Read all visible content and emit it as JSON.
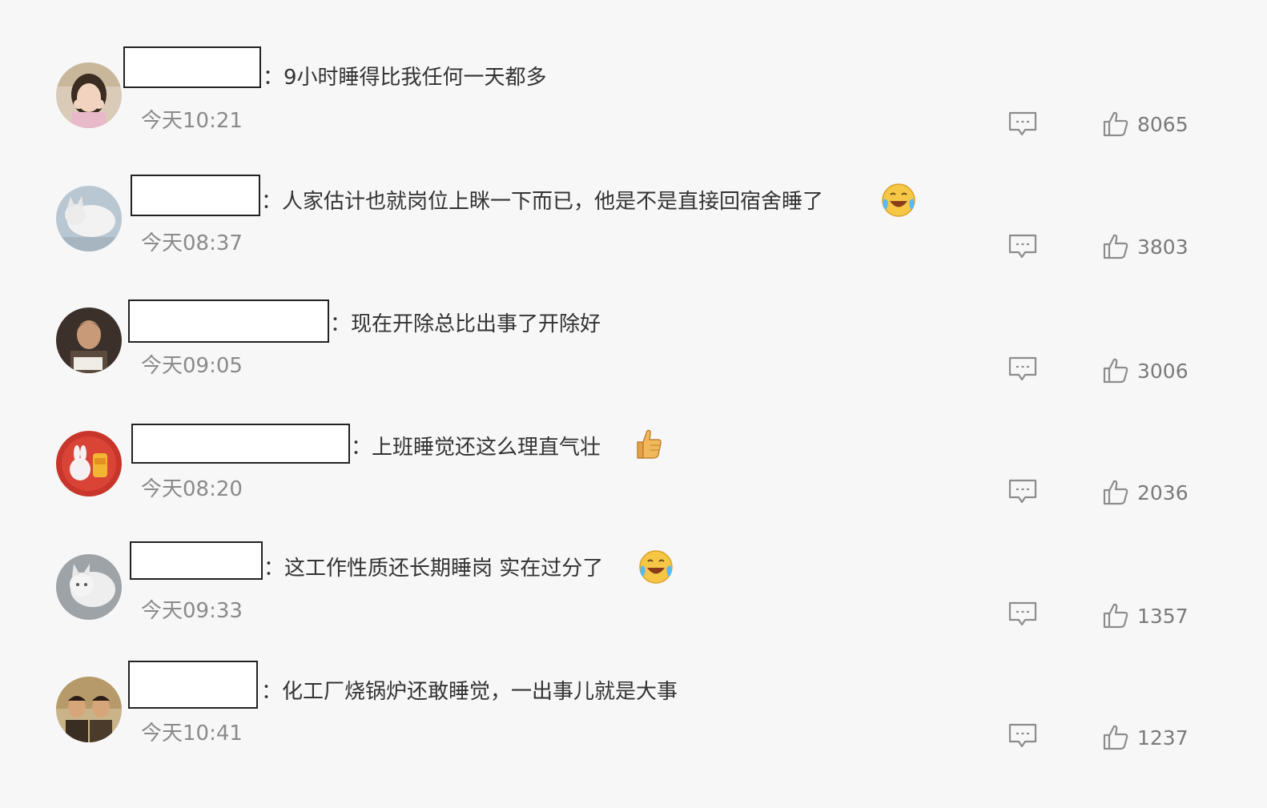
{
  "comments": [
    {
      "separator": "：",
      "text": "9小时睡得比我任何一天都多",
      "emoji": "",
      "time": "今天10:21",
      "likes": "8065",
      "reply_icon": "comment-icon",
      "like_icon": "thumbs-up-icon"
    },
    {
      "separator": "：",
      "text": "人家估计也就岗位上眯一下而已，他是不是直接回宿舍睡了",
      "emoji": "laugh-cry-emoji",
      "time": "今天08:37",
      "likes": "3803",
      "reply_icon": "comment-icon",
      "like_icon": "thumbs-up-icon"
    },
    {
      "separator": "：",
      "text": "现在开除总比出事了开除好",
      "emoji": "",
      "time": "今天09:05",
      "likes": "3006",
      "reply_icon": "comment-icon",
      "like_icon": "thumbs-up-icon"
    },
    {
      "separator": "：",
      "text": "上班睡觉还这么理直气壮",
      "emoji": "thumbs-up-emoji",
      "time": "今天08:20",
      "likes": "2036",
      "reply_icon": "comment-icon",
      "like_icon": "thumbs-up-icon"
    },
    {
      "separator": "：",
      "text": "这工作性质还长期睡岗 实在过分了",
      "emoji": "laugh-cry-emoji",
      "time": "今天09:33",
      "likes": "1357",
      "reply_icon": "comment-icon",
      "like_icon": "thumbs-up-icon"
    },
    {
      "separator": "：",
      "text": "化工厂烧锅炉还敢睡觉，一出事儿就是大事",
      "emoji": "",
      "time": "今天10:41",
      "likes": "1237",
      "reply_icon": "comment-icon",
      "like_icon": "thumbs-up-icon"
    }
  ],
  "colors": {
    "background": "#f7f7f7",
    "text": "#333333",
    "muted": "#8a8a8a",
    "icon": "#8c8c8c"
  }
}
